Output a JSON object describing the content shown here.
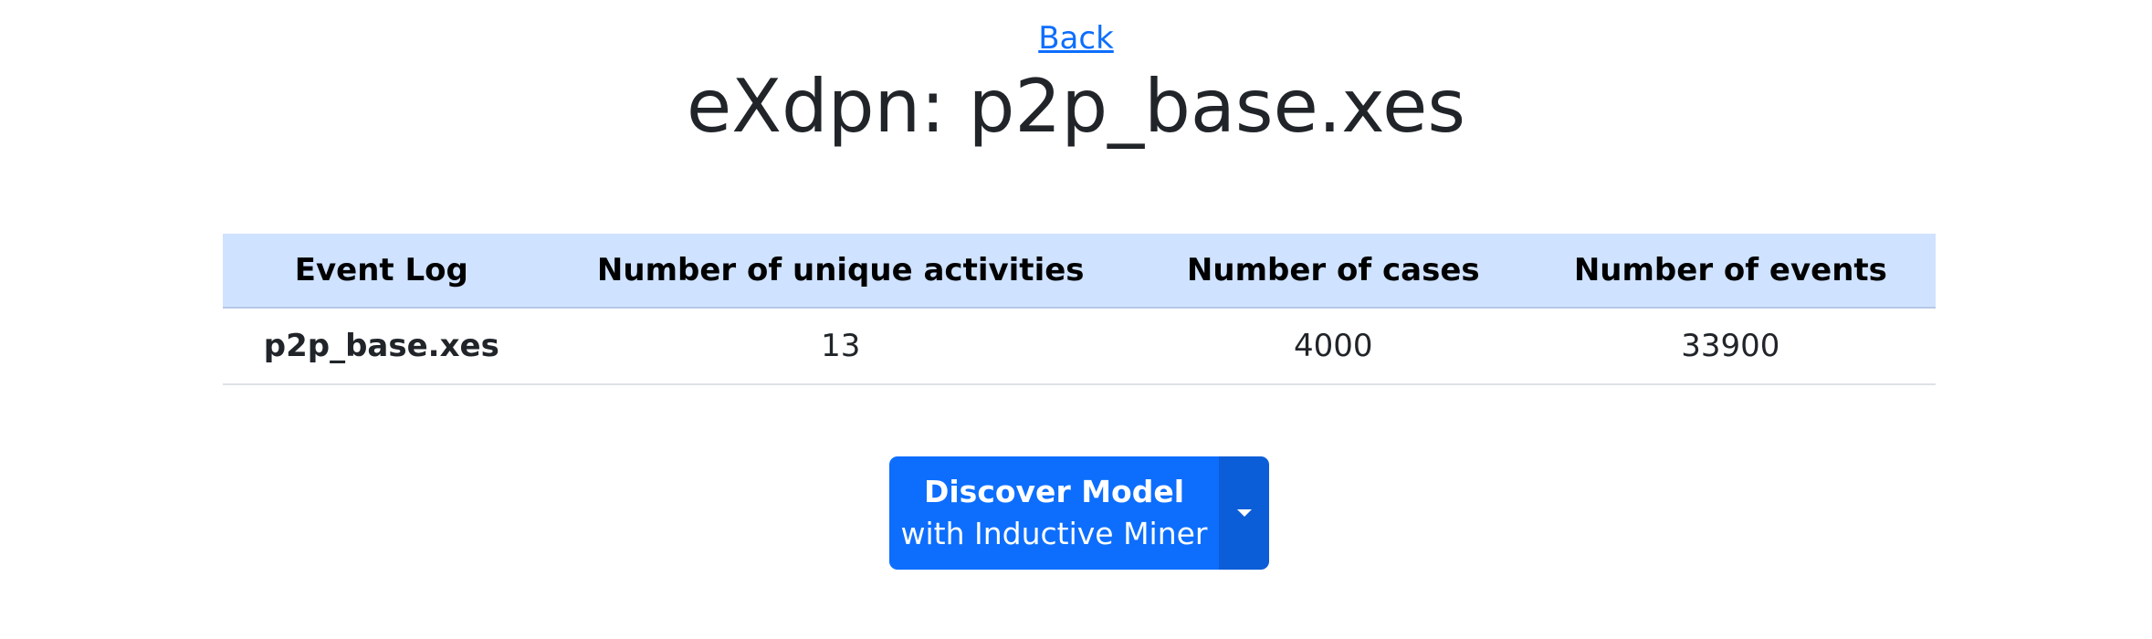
{
  "nav": {
    "back_label": "Back"
  },
  "page": {
    "title": "eXdpn: p2p_base.xes"
  },
  "table": {
    "headers": [
      "Event Log",
      "Number of unique activities",
      "Number of cases",
      "Number of events"
    ],
    "rows": [
      {
        "event_log": "p2p_base.xes",
        "unique_activities": "13",
        "cases": "4000",
        "events": "33900"
      }
    ]
  },
  "discover_button": {
    "line1": "Discover Model",
    "line2": "with Inductive Miner",
    "toggle_icon": "caret-down-icon"
  },
  "colors": {
    "link": "#0d6efd",
    "header_bg": "#cfe2ff",
    "button_bg": "#0d6efd",
    "toggle_bg": "#0b5ed7"
  }
}
